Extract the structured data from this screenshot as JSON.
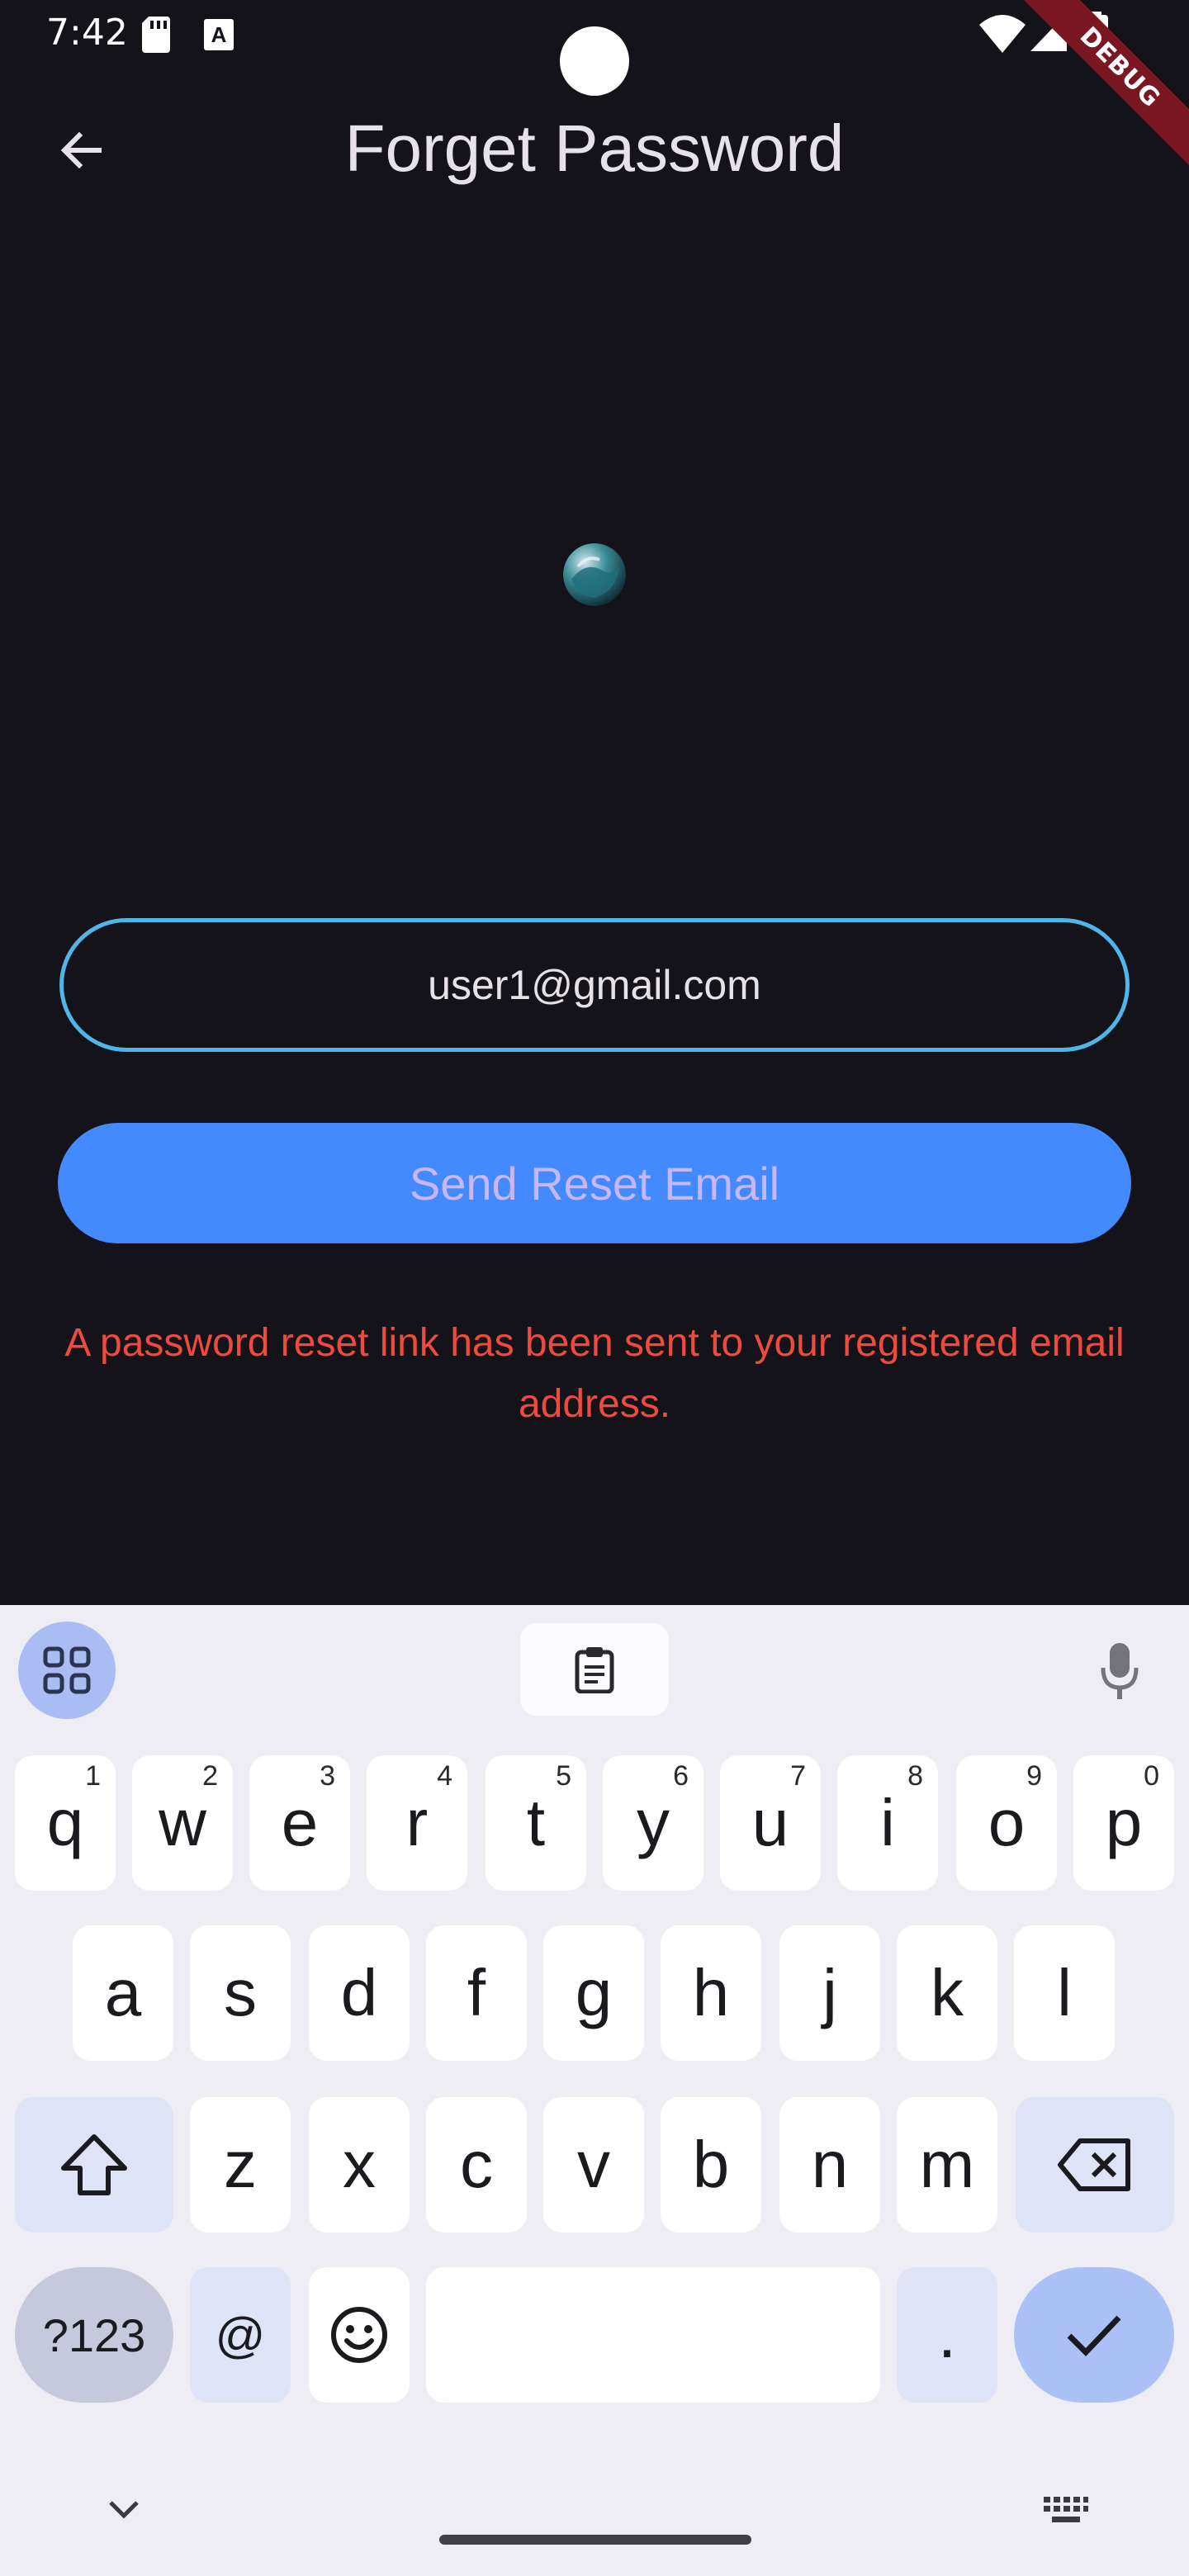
{
  "status_bar": {
    "time": "7:42",
    "a_icon_letter": "A"
  },
  "debug_banner": "DEBUG",
  "app_bar": {
    "back_icon": "arrow-left-icon",
    "title": "Forget Password"
  },
  "logo": {
    "icon": "earth-globe-icon"
  },
  "email_field": {
    "value": "user1@gmail.com"
  },
  "send_button": {
    "label": "Send Reset Email"
  },
  "message": "A password reset link has been sent to your registered email address.",
  "colors": {
    "background": "#15131a",
    "field_border": "#4fb6ea",
    "button_bg": "#448aff",
    "button_text": "#c9b6f4",
    "message_text": "#ef4a3c",
    "keyboard_bg": "#eeedf4"
  },
  "keyboard": {
    "toolbar": {
      "apps_icon": "grid-icon",
      "clipboard_icon": "clipboard-icon",
      "mic_icon": "microphone-icon"
    },
    "row1": [
      {
        "label": "q",
        "hint": "1"
      },
      {
        "label": "w",
        "hint": "2"
      },
      {
        "label": "e",
        "hint": "3"
      },
      {
        "label": "r",
        "hint": "4"
      },
      {
        "label": "t",
        "hint": "5"
      },
      {
        "label": "y",
        "hint": "6"
      },
      {
        "label": "u",
        "hint": "7"
      },
      {
        "label": "i",
        "hint": "8"
      },
      {
        "label": "o",
        "hint": "9"
      },
      {
        "label": "p",
        "hint": "0"
      }
    ],
    "row2": [
      "a",
      "s",
      "d",
      "f",
      "g",
      "h",
      "j",
      "k",
      "l"
    ],
    "row3": [
      "z",
      "x",
      "c",
      "v",
      "b",
      "n",
      "m"
    ],
    "shift_icon": "shift-arrow-icon",
    "backspace_icon": "backspace-icon",
    "symbols_label": "?123",
    "at_label": "@",
    "emoji_icon": "emoji-icon",
    "period_label": ".",
    "enter_icon": "checkmark-icon",
    "hide_icon": "chevron-down-icon",
    "switch_icon": "keyboard-icon"
  }
}
